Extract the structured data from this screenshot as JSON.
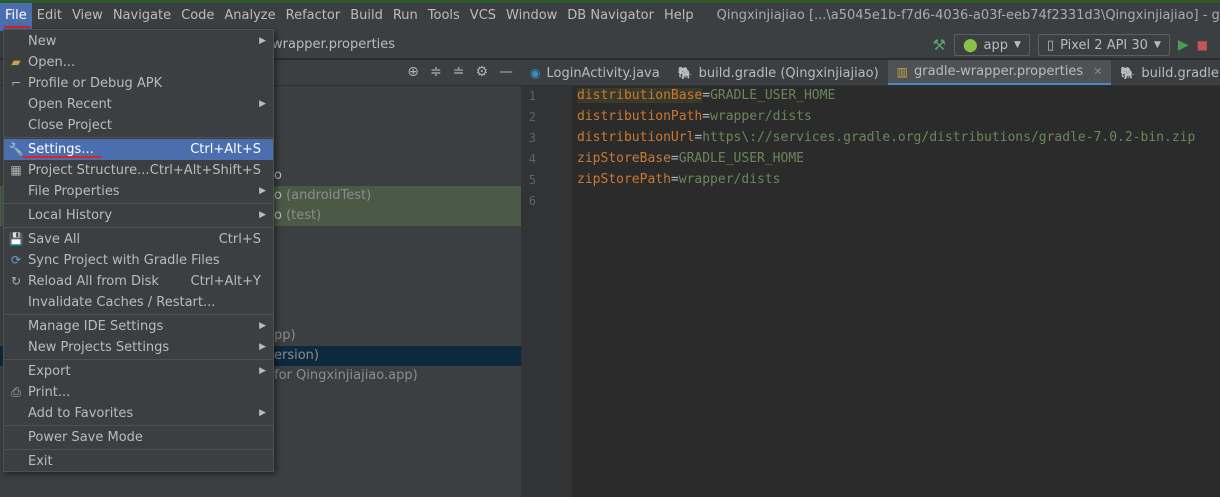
{
  "menubar": {
    "items": [
      "File",
      "Edit",
      "View",
      "Navigate",
      "Code",
      "Analyze",
      "Refactor",
      "Build",
      "Run",
      "Tools",
      "VCS",
      "Window",
      "DB Navigator",
      "Help"
    ],
    "title": "Qingxinjiajiao [...\\a5045e1b-f7d6-4036-a03f-eeb74f2331d3\\Qingxinjiajiao] - gradle-wrapp"
  },
  "toolbar": {
    "crumb": "wrapper.properties",
    "config": "app",
    "device": "Pixel 2 API 30"
  },
  "tree": {
    "row1": "o",
    "row2": "o",
    "row2_dim": "(androidTest)",
    "row3": "o",
    "row3_dim": "(test)",
    "row4": "pp)",
    "row5": "ersion)",
    "row6": "for Qingxinjiajiao.app)"
  },
  "tabs": [
    {
      "label": "LoginActivity.java",
      "icon": "class-icon"
    },
    {
      "label": "build.gradle (Qingxinjiajiao)",
      "icon": "gradle-icon"
    },
    {
      "label": "gradle-wrapper.properties",
      "icon": "properties-icon",
      "active": true
    },
    {
      "label": "build.gradle (:app)",
      "icon": "gradle-icon"
    }
  ],
  "editor": {
    "lines": [
      {
        "n": "1",
        "key": "distributionBase",
        "sep": "=",
        "val": "GRADLE_USER_HOME"
      },
      {
        "n": "2",
        "key": "distributionPath",
        "sep": "=",
        "val": "wrapper/dists"
      },
      {
        "n": "3",
        "key": "distributionUrl",
        "sep": "=",
        "val": "https\\://services.gradle.org/distributions/gradle-7.0.2-bin.zip"
      },
      {
        "n": "4",
        "key": "zipStoreBase",
        "sep": "=",
        "val": "GRADLE_USER_HOME"
      },
      {
        "n": "5",
        "key": "zipStorePath",
        "sep": "=",
        "val": "wrapper/dists"
      },
      {
        "n": "6",
        "key": "",
        "sep": "",
        "val": ""
      }
    ]
  },
  "file_menu": {
    "new": "New",
    "open": "Open...",
    "profile": "Profile or Debug APK",
    "open_recent": "Open Recent",
    "close_project": "Close Project",
    "settings": "Settings...",
    "settings_sc": "Ctrl+Alt+S",
    "project_structure": "Project Structure...",
    "project_structure_sc": "Ctrl+Alt+Shift+S",
    "file_properties": "File Properties",
    "local_history": "Local History",
    "save_all": "Save All",
    "save_all_sc": "Ctrl+S",
    "sync": "Sync Project with Gradle Files",
    "reload": "Reload All from Disk",
    "reload_sc": "Ctrl+Alt+Y",
    "invalidate": "Invalidate Caches / Restart...",
    "manage_ide": "Manage IDE Settings",
    "new_projects": "New Projects Settings",
    "export": "Export",
    "print": "Print...",
    "favorites": "Add to Favorites",
    "power_save": "Power Save Mode",
    "exit": "Exit"
  }
}
